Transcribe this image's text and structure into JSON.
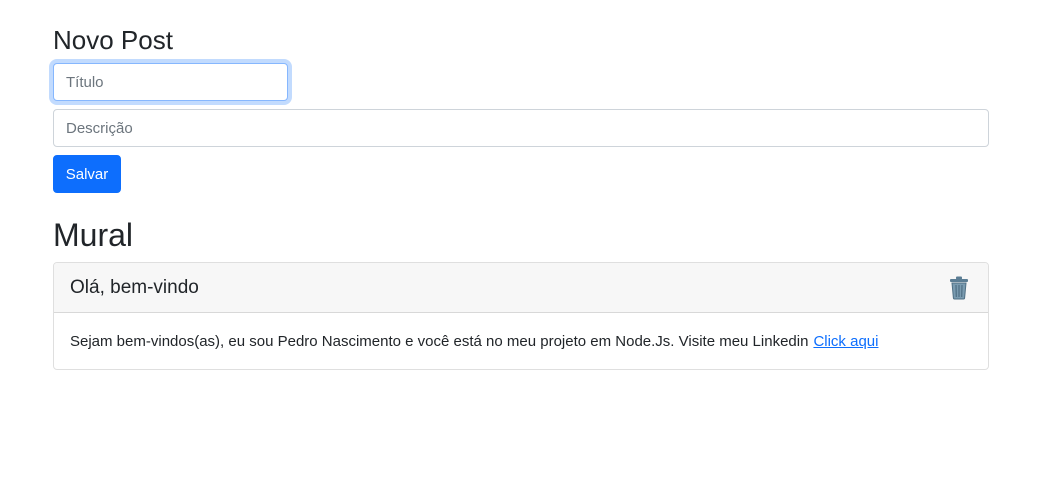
{
  "form": {
    "heading": "Novo Post",
    "title_placeholder": "Título",
    "description_placeholder": "Descrição",
    "save_label": "Salvar"
  },
  "mural": {
    "heading": "Mural",
    "posts": [
      {
        "title": "Olá, bem-vindo",
        "body": "Sejam bem-vindos(as), eu sou Pedro Nascimento e você está no meu projeto em Node.Js. Visite meu Linkedin",
        "link_text": "Click aqui",
        "icon": "trash-icon"
      }
    ]
  },
  "colors": {
    "primary": "#0d6efd",
    "header_bg": "#f7f7f7",
    "focus_border": "#86b7fe",
    "text": "#212529"
  }
}
